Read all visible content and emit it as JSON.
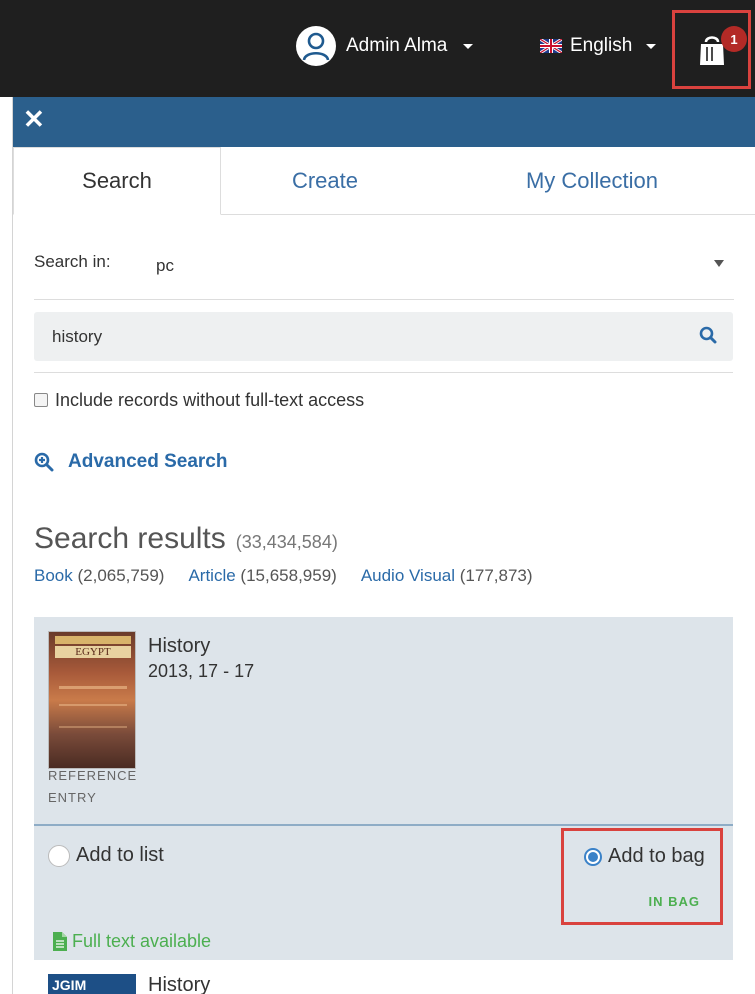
{
  "topbar": {
    "user_name": "Admin Alma",
    "language": "English",
    "bag_count": "1"
  },
  "tabs": {
    "search": "Search",
    "create": "Create",
    "my_collection": "My Collection"
  },
  "search": {
    "search_in_label": "Search in:",
    "search_in_value": "pc",
    "query": "history",
    "include_label": "Include records without full-text access",
    "advanced_label": "Advanced Search"
  },
  "results": {
    "heading": "Search results",
    "count": "(33,434,584)",
    "facets": [
      {
        "name": "Book",
        "count": "(2,065,759)"
      },
      {
        "name": "Article",
        "count": "(15,658,959)"
      },
      {
        "name": "Audio Visual",
        "count": "(177,873)"
      }
    ],
    "items": [
      {
        "title": "History",
        "meta": "2013, 17 - 17",
        "type_line1": "REFERENCE",
        "type_line2": "ENTRY",
        "cover_text": "EGYPT",
        "add_to_list": "Add to list",
        "add_to_bag": "Add to bag",
        "in_bag": "IN BAG",
        "full_text": "Full text available"
      },
      {
        "title": "History",
        "cover_text": "JGIM"
      }
    ]
  },
  "colors": {
    "topbar": "#1f1f1f",
    "panel_header": "#2b5f8c",
    "link": "#2a6aa8",
    "highlight_border": "#d9423e",
    "badge": "#b32a26",
    "in_bag": "#4caf50",
    "card_bg": "#dde4ea"
  },
  "icons": [
    "user-icon",
    "uk-flag-icon",
    "bag-icon",
    "close-icon",
    "search-icon",
    "zoom-in-icon",
    "document-icon"
  ]
}
